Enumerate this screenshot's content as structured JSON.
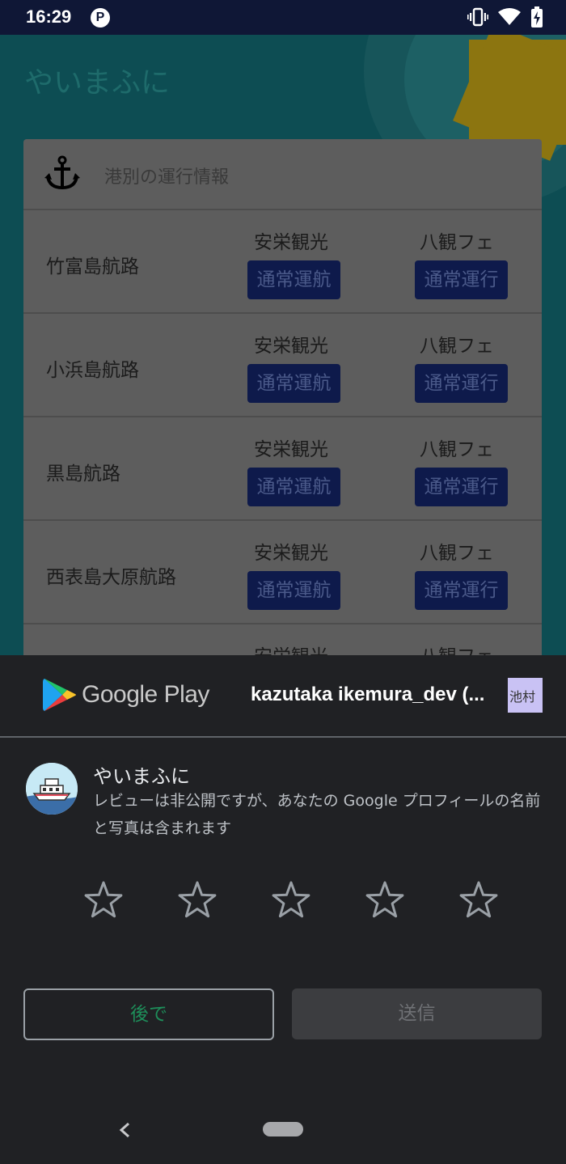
{
  "status_bar": {
    "time": "16:29",
    "p_icon_letter": "P",
    "icons": [
      "vibrate-icon",
      "wifi-icon",
      "battery-charging-icon"
    ]
  },
  "app": {
    "title": "やいまふに",
    "port_info_header": "港別の運行情報",
    "routes": [
      {
        "name": "竹富島航路",
        "operators": [
          {
            "name": "安栄観光",
            "status": "通常運航"
          },
          {
            "name": "八観フェ",
            "status": "通常運行"
          }
        ]
      },
      {
        "name": "小浜島航路",
        "operators": [
          {
            "name": "安栄観光",
            "status": "通常運航"
          },
          {
            "name": "八観フェ",
            "status": "通常運行"
          }
        ]
      },
      {
        "name": "黒島航路",
        "operators": [
          {
            "name": "安栄観光",
            "status": "通常運航"
          },
          {
            "name": "八観フェ",
            "status": "通常運行"
          }
        ]
      },
      {
        "name": "西表島大原航路",
        "operators": [
          {
            "name": "安栄観光",
            "status": "通常運航"
          },
          {
            "name": "八観フェ",
            "status": "通常運行"
          }
        ]
      },
      {
        "name": "",
        "operators": [
          {
            "name": "安栄観光",
            "status": ""
          },
          {
            "name": "八観フェ",
            "status": ""
          }
        ]
      }
    ]
  },
  "review_sheet": {
    "store_name": "Google Play",
    "account": "kazutaka ikemura_dev (...",
    "avatar_text": "池村",
    "app_name": "やいまふに",
    "note": "レビューは非公開ですが、あなたの Google プロフィールの名前と写真は含まれます",
    "rating": 0,
    "max_rating": 5,
    "later_label": "後で",
    "submit_label": "送信"
  },
  "colors": {
    "later_text": "#1e8e5a",
    "sheet_bg": "#202124",
    "status_badge_bg": "#0e1a4b"
  }
}
